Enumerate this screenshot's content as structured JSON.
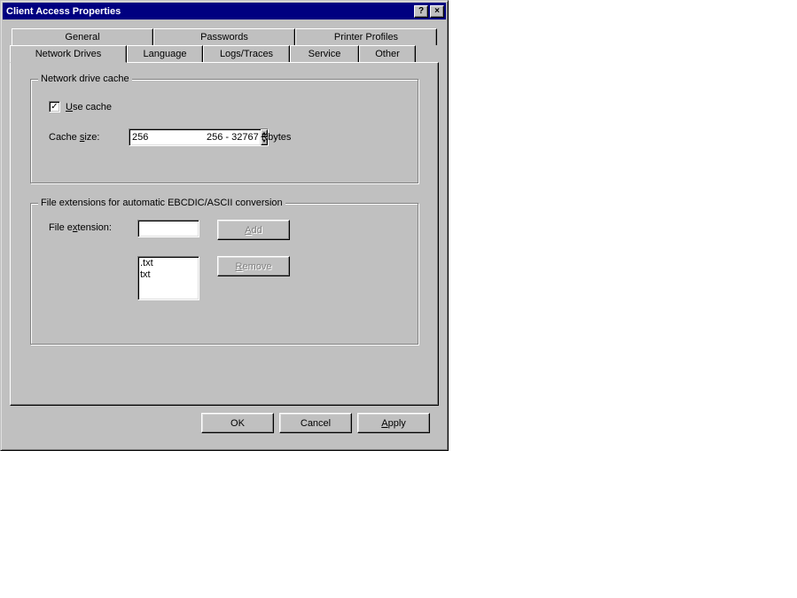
{
  "window": {
    "title": "Client Access Properties"
  },
  "tabs": {
    "row1": [
      "General",
      "Passwords",
      "Printer Profiles"
    ],
    "row2": [
      "Network Drives",
      "Language",
      "Logs/Traces",
      "Service",
      "Other"
    ],
    "active": "Network Drives"
  },
  "group_cache": {
    "title": "Network drive cache",
    "use_cache_label_pre": "",
    "use_cache_underline": "U",
    "use_cache_label_post": "se cache",
    "use_cache_checked": true,
    "size_label_pre": "Cache ",
    "size_underline": "s",
    "size_label_post": "ize:",
    "size_value": "256",
    "size_hint": "256 - 32767 Kbytes"
  },
  "group_ext": {
    "title": "File extensions for automatic EBCDIC/ASCII conversion",
    "ext_label_pre": "File e",
    "ext_underline": "x",
    "ext_label_post": "tension:",
    "ext_value": "",
    "add_underline": "A",
    "add_post": "dd",
    "remove_underline": "R",
    "remove_post": "emove",
    "list": [
      ".txt",
      "txt"
    ]
  },
  "buttons": {
    "ok": "OK",
    "cancel": "Cancel",
    "apply_underline": "A",
    "apply_post": "pply"
  }
}
